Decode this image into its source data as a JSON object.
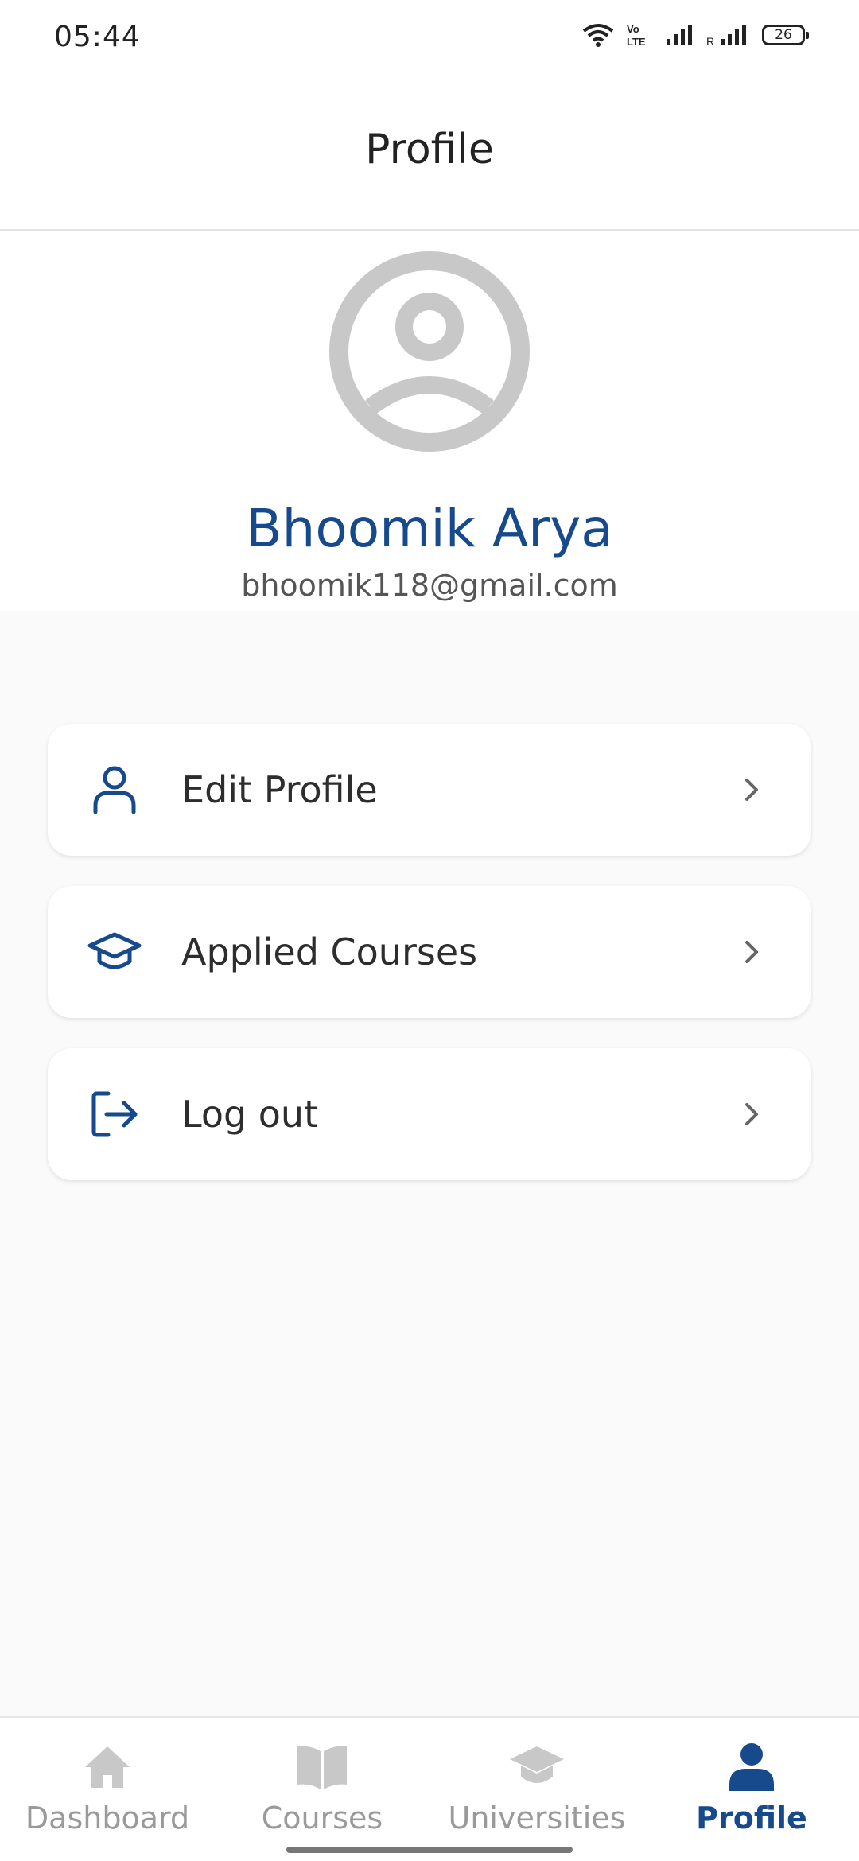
{
  "status_bar": {
    "time": "05:44",
    "battery": "26",
    "icons": [
      "wifi-icon",
      "volte-icon",
      "signal-icon",
      "roaming-signal-icon",
      "battery-icon"
    ]
  },
  "app_bar": {
    "title": "Profile"
  },
  "profile": {
    "name": "Bhoomik Arya",
    "email": "bhoomik118@gmail.com",
    "avatar_icon": "account-circle-icon"
  },
  "menu": {
    "items": [
      {
        "label": "Edit Profile",
        "icon": "person-icon"
      },
      {
        "label": "Applied Courses",
        "icon": "graduation-cap-icon"
      },
      {
        "label": "Log out",
        "icon": "logout-icon"
      }
    ]
  },
  "bottom_nav": {
    "items": [
      {
        "label": "Dashboard",
        "icon": "home-icon",
        "active": false
      },
      {
        "label": "Courses",
        "icon": "book-icon",
        "active": false
      },
      {
        "label": "Universities",
        "icon": "graduation-cap-icon",
        "active": false
      },
      {
        "label": "Profile",
        "icon": "person-icon",
        "active": true
      }
    ]
  },
  "colors": {
    "accent": "#164a8c",
    "inactive": "#9a9a9a",
    "avatar_grey": "#c8c8c8",
    "background": "#fafafa"
  }
}
